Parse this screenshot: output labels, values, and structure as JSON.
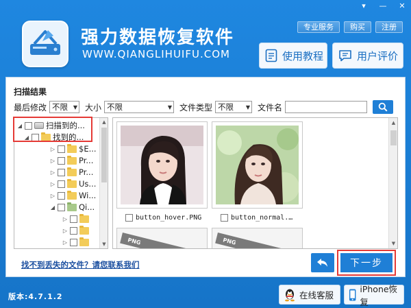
{
  "window": {
    "controls": [
      "▾",
      "—",
      "✕"
    ]
  },
  "app": {
    "title": "强力数据恢复软件",
    "url": "WWW.QIANGLIHUIFU.COM"
  },
  "top_links": [
    "专业服务",
    "购买",
    "注册"
  ],
  "big_buttons": {
    "tutorial": "使用教程",
    "review": "用户评价"
  },
  "scan": {
    "title": "扫描结果",
    "filters": {
      "modified_label": "最后修改",
      "modified_value": "不限",
      "size_label": "大小",
      "size_value": "不限",
      "filetype_label": "文件类型",
      "filetype_value": "不限",
      "filename_label": "文件名",
      "filename_value": ""
    }
  },
  "tree": [
    {
      "label": "扫描到的..."
    },
    {
      "label": "找到的..."
    },
    {
      "label": "$E..."
    },
    {
      "label": "Pr..."
    },
    {
      "label": "Pr..."
    },
    {
      "label": "Us..."
    },
    {
      "label": "Wi..."
    },
    {
      "label": "Qi..."
    },
    {
      "label": ""
    },
    {
      "label": ""
    },
    {
      "label": ""
    }
  ],
  "gallery": [
    {
      "filename": "button_hover.PNG"
    },
    {
      "filename": "button_normal.…"
    }
  ],
  "ghost_tag": "PNG",
  "help_link": "找不到丢失的文件？请您联系我们",
  "next_button": "下一步",
  "version": "版本:4.7.1.2",
  "footer": {
    "qq": "在线客服",
    "iphone": "iPhone恢复"
  },
  "colors": {
    "header_blue": "#1f87e0",
    "button_blue": "#1f7fd6",
    "highlight_red": "#e53935"
  }
}
